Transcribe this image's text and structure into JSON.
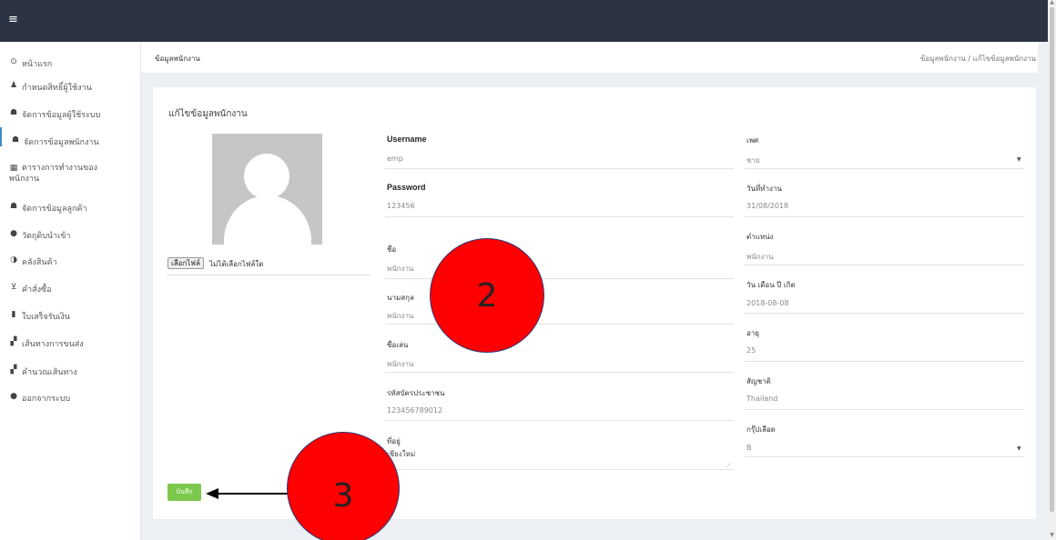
{
  "topbar": {
    "menu_icon": "≡"
  },
  "sidebar": {
    "items": [
      {
        "icon": "clock-icon",
        "glyph": "⊙",
        "label": "หน้าแรก"
      },
      {
        "icon": "user-icon",
        "glyph": "♟",
        "label": "กำหนดสิทธิ์ผู้ใช้งาน"
      },
      {
        "icon": "users-icon",
        "glyph": "☗",
        "label": "จัดการข้อมูลผู้ใช้ระบบ"
      },
      {
        "icon": "users-icon",
        "glyph": "☗",
        "label": "จัดการข้อมูลพนักงาน"
      },
      {
        "icon": "table-icon",
        "glyph": "▦",
        "label": "ตารางการทำงานของ",
        "label2": "พนักงาน"
      },
      {
        "icon": "users-icon",
        "glyph": "☗",
        "label": "จัดการข้อมูลลูกค้า"
      },
      {
        "icon": "product-hunt-icon",
        "glyph": "●",
        "label": "วัตถุดิบนำเข้า"
      },
      {
        "icon": "adjust-icon",
        "glyph": "◑",
        "label": "คลังสินค้า"
      },
      {
        "icon": "cart-icon",
        "glyph": "⊻",
        "label": "คำสั่งซื้อ"
      },
      {
        "icon": "file-icon",
        "glyph": "▮",
        "label": "ใบเสร็จรับเงิน"
      },
      {
        "icon": "map-icon",
        "glyph": "▞",
        "label": "เส้นทางการขนส่ง"
      },
      {
        "icon": "map-icon",
        "glyph": "▞",
        "label": "คำนวณเส้นทาง"
      },
      {
        "icon": "info-icon",
        "glyph": "●",
        "label": "ออกจากระบบ"
      }
    ]
  },
  "header": {
    "title": "ข้อมูลพนักงาน",
    "breadcrumb": "ข้อมูลพนักงาน  /  แก้ไขข้อมูลพนักงาน"
  },
  "form": {
    "title": "แก้ไขข้อมูลพนักงาน",
    "file_button": "เลือกไฟล์",
    "file_status": "ไม่ได้เลือกไฟล์ใด",
    "username_label": "Username",
    "username_value": "emp",
    "password_label": "Password",
    "password_value": "123456",
    "firstname_label": "ชื่อ",
    "firstname_value": "พนักงาน",
    "lastname_label": "นามสกุล",
    "lastname_value": "พนักงาน",
    "nickname_label": "ชื่อเล่น",
    "nickname_value": "พนักงาน",
    "idcard_label": "รหัสบัตรประชาชน",
    "idcard_value": "123456789012",
    "address_label": "ที่อยู่",
    "address_value": "เชียงใหม่",
    "gender_label": "เพศ",
    "gender_value": "ชาย",
    "startdate_label": "วันที่ทำงาน",
    "startdate_value": "31/08/2018",
    "position_label": "ตำแหน่ง",
    "position_value": "พนักงาน",
    "birthdate_label": "วัน เดือน ปี เกิด",
    "birthdate_value": "2018-08-08",
    "age_label": "อายุ",
    "age_value": "25",
    "nationality_label": "สัญชาติ",
    "nationality_value": "Thailand",
    "blood_label": "กรุ๊ปเลือด",
    "blood_value": "B",
    "save_label": "บันทึก"
  },
  "annotations": {
    "marker_2": "2",
    "marker_3": "3",
    "marker_color": "#ff0000"
  },
  "colors": {
    "topbar": "#2c3443",
    "save_button": "#7bc84c",
    "active_nav": "#3c8dbc"
  }
}
